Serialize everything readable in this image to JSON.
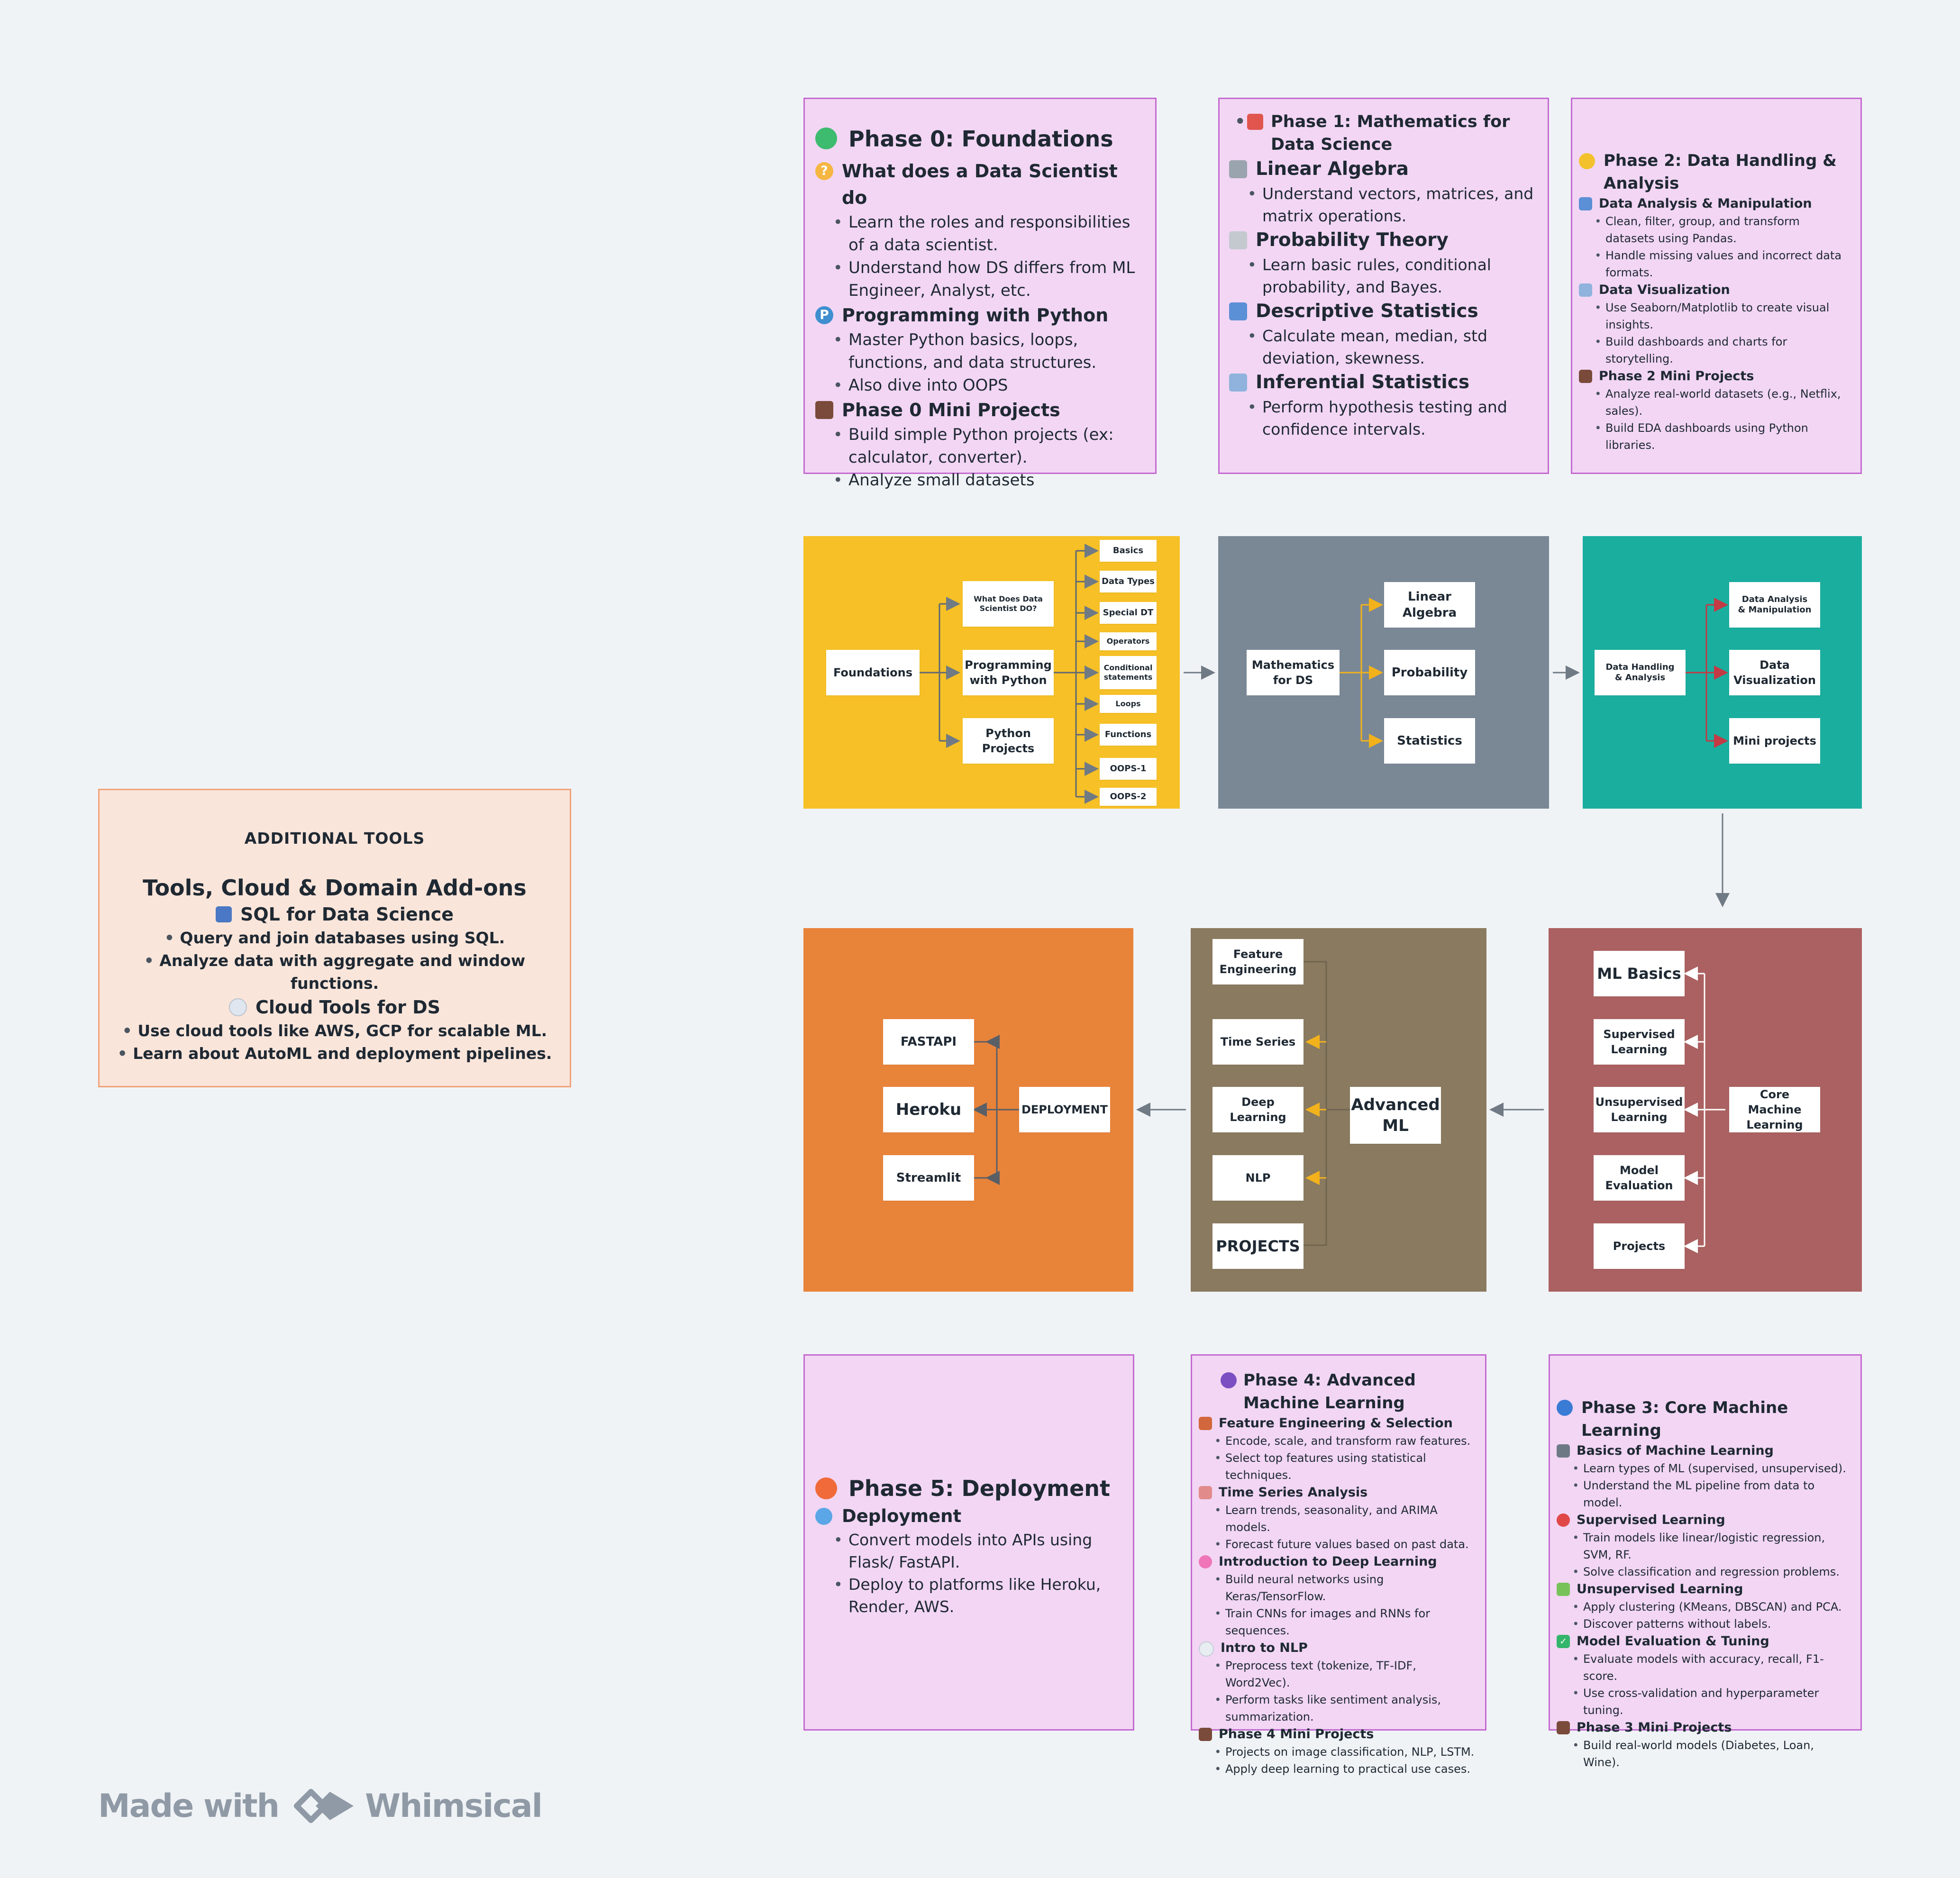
{
  "phase0": {
    "title": "Phase 0: Foundations",
    "sections": [
      {
        "heading": "What does a Data Scientist do",
        "icon": "thinking-face-icon",
        "items": [
          "Learn the roles and responsibilities of a data scientist.",
          "Understand how DS differs from ML Engineer, Analyst, etc."
        ]
      },
      {
        "heading": "Programming with Python",
        "icon": "python-icon",
        "items": [
          "Master Python basics, loops, functions, and data structures.",
          "Also dive into OOPS"
        ]
      },
      {
        "heading": "Phase 0 Mini Projects",
        "icon": "briefcase-icon",
        "items": [
          "Build simple Python projects (ex: calculator, converter).",
          "Analyze small datasets"
        ]
      }
    ]
  },
  "phase1": {
    "title": "Phase 1: Mathematics for Data Science",
    "sections": [
      {
        "heading": "Linear Algebra",
        "icon": "ruler-icon",
        "items": [
          "Understand vectors, matrices, and matrix operations."
        ]
      },
      {
        "heading": "Probability Theory",
        "icon": "dice-icon",
        "items": [
          "Learn basic rules, conditional probability, and Bayes."
        ]
      },
      {
        "heading": "Descriptive Statistics",
        "icon": "bar-chart-icon",
        "items": [
          "Calculate mean, median, std deviation, skewness."
        ]
      },
      {
        "heading": "Inferential Statistics",
        "icon": "line-chart-icon",
        "items": [
          "Perform hypothesis testing and confidence intervals."
        ]
      }
    ]
  },
  "phase2": {
    "title": "Phase 2: Data Handling & Analysis",
    "sections": [
      {
        "heading": "Data Analysis & Manipulation",
        "icon": "bar-chart-icon",
        "items": [
          "Clean, filter, group, and transform datasets using Pandas.",
          "Handle missing values and incorrect data formats."
        ]
      },
      {
        "heading": "Data Visualization",
        "icon": "line-chart-icon",
        "items": [
          "Use Seaborn/Matplotlib to create visual insights.",
          "Build dashboards and charts for storytelling."
        ]
      },
      {
        "heading": "Phase 2 Mini Projects",
        "icon": "briefcase-icon",
        "items": [
          "Analyze real-world datasets (e.g., Netflix, sales).",
          "Build EDA dashboards using Python libraries."
        ]
      }
    ]
  },
  "phase3": {
    "title": "Phase 3: Core Machine Learning",
    "sections": [
      {
        "heading": "Basics of Machine Learning",
        "icon": "robot-icon",
        "items": [
          "Learn types of ML (supervised, unsupervised).",
          "Understand the ML pipeline from data to model."
        ]
      },
      {
        "heading": "Supervised Learning",
        "icon": "target-icon",
        "items": [
          "Train models like linear/logistic regression, SVM, RF.",
          "Solve classification and regression problems."
        ]
      },
      {
        "heading": "Unsupervised Learning",
        "icon": "puzzle-icon",
        "items": [
          "Apply clustering (KMeans, DBSCAN) and PCA.",
          "Discover patterns without labels."
        ]
      },
      {
        "heading": "Model Evaluation & Tuning",
        "icon": "check-box-icon",
        "items": [
          "Evaluate models with accuracy, recall, F1-score.",
          "Use cross-validation and hyperparameter tuning."
        ]
      },
      {
        "heading": "Phase 3 Mini Projects",
        "icon": "briefcase-icon",
        "items": [
          "Build real-world models (Diabetes, Loan, Wine)."
        ]
      }
    ]
  },
  "phase4": {
    "title": "Phase 4: Advanced Machine Learning",
    "sections": [
      {
        "heading": "Feature Engineering & Selection",
        "icon": "bricks-icon",
        "items": [
          "Encode, scale, and transform raw features.",
          "Select top features using statistical techniques."
        ]
      },
      {
        "heading": "Time Series Analysis",
        "icon": "trend-down-chart-icon",
        "items": [
          "Learn trends, seasonality, and ARIMA models.",
          "Forecast future values based on past data."
        ]
      },
      {
        "heading": "Introduction to Deep Learning",
        "icon": "brain-icon",
        "items": [
          "Build neural networks using Keras/TensorFlow.",
          "Train CNNs for images and RNNs for sequences."
        ]
      },
      {
        "heading": "Intro to NLP",
        "icon": "speech-bubble-icon",
        "items": [
          "Preprocess text (tokenize, TF-IDF, Word2Vec).",
          "Perform tasks like sentiment analysis, summarization."
        ]
      },
      {
        "heading": "Phase 4 Mini Projects",
        "icon": "briefcase-icon",
        "items": [
          "Projects on image classification, NLP, LSTM.",
          "Apply deep learning to practical use cases."
        ]
      }
    ]
  },
  "phase5": {
    "title": "Phase 5: Deployment",
    "sections": [
      {
        "heading": "Deployment",
        "icon": "globe-icon",
        "items": [
          "Convert models into APIs using Flask/ FastAPI.",
          "Deploy to platforms like Heroku, Render, AWS."
        ]
      }
    ]
  },
  "tools": {
    "kicker": "ADDITIONAL TOOLS",
    "title": "Tools, Cloud & Domain Add-ons",
    "sections": [
      {
        "heading": "SQL for Data Science",
        "icon": "database-icon",
        "items": [
          "Query and join databases using SQL.",
          "Analyze data with aggregate and window functions."
        ]
      },
      {
        "heading": "Cloud Tools for DS",
        "icon": "cloud-icon",
        "items": [
          "Use cloud tools like AWS, GCP for scalable ML.",
          "Learn about AutoML and deployment pipelines."
        ]
      }
    ]
  },
  "diagram": {
    "foundations": {
      "root": "Foundations",
      "children": [
        "What Does Data Scientist DO?",
        "Programming with Python",
        "Python Projects"
      ],
      "python_topics": [
        "Basics",
        "Data Types",
        "Special DT",
        "Operators",
        "Conditional statements",
        "Loops",
        "Functions",
        "OOPS-1",
        "OOPS-2"
      ]
    },
    "math": {
      "root": "Mathematics for DS",
      "children": [
        "Linear Algebra",
        "Probability",
        "Statistics"
      ]
    },
    "data": {
      "root": "Data Handling & Analysis",
      "children": [
        "Data Analysis & Manipulation",
        "Data Visualization",
        "Mini projects"
      ]
    },
    "core_ml": {
      "root": "Core Machine Learning",
      "children": [
        "ML Basics",
        "Supervised Learning",
        "Unsupervised Learning",
        "Model Evaluation",
        "Projects"
      ]
    },
    "advanced_ml": {
      "root": "Advanced ML",
      "children": [
        "Feature Engineering",
        "Time Series",
        "Deep Learning",
        "NLP",
        "PROJECTS"
      ]
    },
    "deployment": {
      "root": "DEPLOYMENT",
      "children": [
        "FASTAPI",
        "Heroku",
        "Streamlit"
      ]
    }
  },
  "colors": {
    "card_fill": "#f2d6f4",
    "card_border": "#c46bd0",
    "foundations": "#f6c026",
    "math": "#7a8896",
    "data": "#1aae9f",
    "core_ml": "#ab6161",
    "advanced_ml": "#8a7a5f",
    "deployment": "#e8833a",
    "tools_fill": "#fae5da",
    "tools_border": "#f0a27b"
  },
  "brand": {
    "made_with": "Made with",
    "name": "Whimsical",
    "icon": "whimsical-logo-icon"
  }
}
